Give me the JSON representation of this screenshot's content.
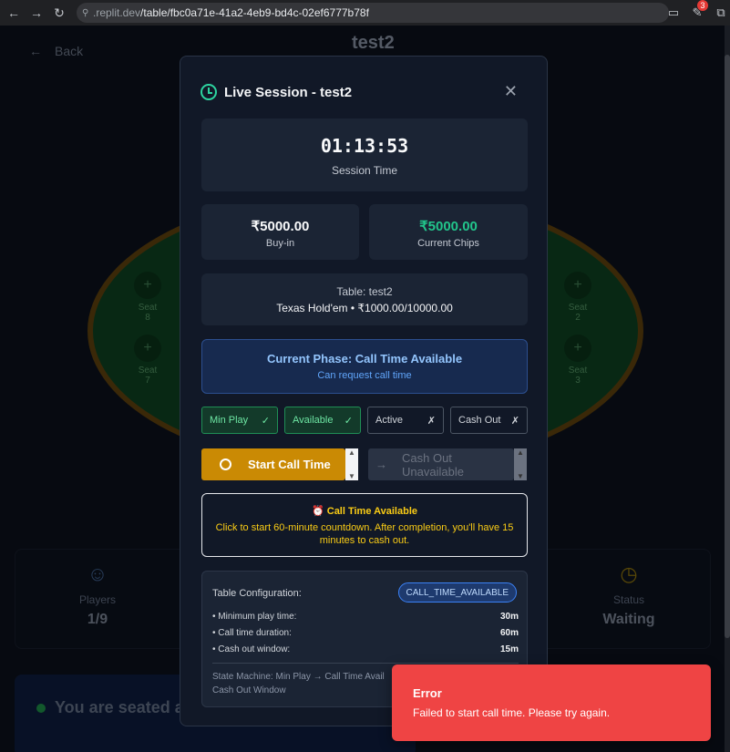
{
  "browser": {
    "url_host": ".replit.dev",
    "url_path": "/table/fbc0a71e-41a2-4eb9-bd4c-02ef6777b78f",
    "notification_count": "3"
  },
  "background": {
    "back_label": "Back",
    "page_title": "test2",
    "seats": [
      {
        "label": "Seat",
        "num": "8"
      },
      {
        "label": "Seat",
        "num": "7"
      },
      {
        "label": "Seat",
        "num": "2"
      },
      {
        "label": "Seat",
        "num": "3"
      }
    ],
    "stats": {
      "players_label": "Players",
      "players_value": "1/9",
      "status_label": "Status",
      "status_value": "Waiting"
    },
    "seated_text": "You are seated a"
  },
  "modal": {
    "title": "Live Session - test2",
    "session_time": "01:13:53",
    "session_time_label": "Session Time",
    "buyin_amount": "₹5000.00",
    "buyin_label": "Buy-in",
    "chips_amount": "₹5000.00",
    "chips_label": "Current Chips",
    "table_line": "Table: test2",
    "game_line": "Texas Hold'em • ₹1000.00/10000.00",
    "phase_title": "Current Phase: Call Time Available",
    "phase_sub": "Can request call time",
    "status_pills": [
      {
        "label": "Min Play",
        "mark": "✓"
      },
      {
        "label": "Available",
        "mark": "✓"
      },
      {
        "label": "Active",
        "mark": "✗"
      },
      {
        "label": "Cash Out",
        "mark": "✗"
      }
    ],
    "start_button": "Start Call Time",
    "cashout_button": "Cash Out Unavailable",
    "calltime_title": "Call Time Available",
    "calltime_body": "Click to start 60-minute countdown. After completion, you'll have 15 minutes to cash out.",
    "config": {
      "title": "Table Configuration:",
      "state_badge": "CALL_TIME_AVAILABLE",
      "rows": [
        {
          "label": "• Minimum play time:",
          "value": "30m"
        },
        {
          "label": "• Call time duration:",
          "value": "60m"
        },
        {
          "label": "• Cash out window:",
          "value": "15m"
        }
      ],
      "state_machine": "State Machine: Min Play → Call Time Avail",
      "state_machine_2": "Cash Out Window"
    }
  },
  "toast": {
    "title": "Error",
    "message": "Failed to start call time. Please try again."
  }
}
